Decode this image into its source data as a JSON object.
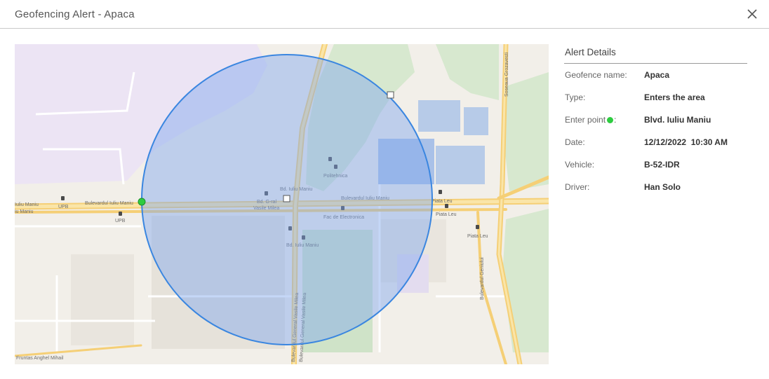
{
  "dialog": {
    "title": "Geofencing Alert - Apaca",
    "close_icon": "close-icon"
  },
  "colors": {
    "geofence_fill": "#7fa7ee",
    "geofence_stroke": "#3a86e0",
    "enter_point": "#2ecc40",
    "map_background": "#f2efe9",
    "park": "#d7e8cf",
    "road": "#f7d98b"
  },
  "map": {
    "labels": {
      "bulevardul_iuliu_maniu_main": "Bulevardul Iuliu Maniu",
      "bulevardul_iuliu_maniu_left": "Bulevardul Iuliu Maniu",
      "iuliu_maniu_edge": "Iuliu Maniu",
      "iuliu_maniu_edge2": "iu Maniu",
      "upb_1": "UPB",
      "upb_2": "UPB",
      "politehnica": "Politehnica",
      "bd_iuliu_maniu_1": "Bd. Iuliu Maniu",
      "bd_iuliu_maniu_2": "Bd. Iuliu Maniu",
      "bd_g_ral": "Bd. G-ral",
      "vasile_milea": "Vasile Milea",
      "fac_de_electronica": "Fac de Electronica",
      "piata_leu_1": "Piata Leu",
      "piata_leu_2": "Piata Leu",
      "piata_leu_3": "Piata Leu",
      "bulevardul_vasile_milea_1": "Bulevardul General Vasile Milea",
      "bulevardul_vasile_milea_2": "Bulevardul General Vasile Milea",
      "bulevardul_geniului": "Bulevardul Geniului",
      "soseaua_grozavesti": "Soseaua Grozavesti",
      "fruntas_anghel": "Fruntas Anghel Mihail"
    }
  },
  "alert_details": {
    "heading": "Alert Details",
    "rows": [
      {
        "label": "Geofence name:",
        "value": "Apaca"
      },
      {
        "label": "Type:",
        "value": "Enters the area"
      },
      {
        "label": "Enter point",
        "label_suffix": ":",
        "value": "Blvd. Iuliu Maniu",
        "icon": "green-dot-icon"
      },
      {
        "label": "Date:",
        "value": "12/12/2022  10:30 AM"
      },
      {
        "label": "Vehicle:",
        "value": "B-52-IDR"
      },
      {
        "label": "Driver:",
        "value": "Han Solo"
      }
    ]
  }
}
